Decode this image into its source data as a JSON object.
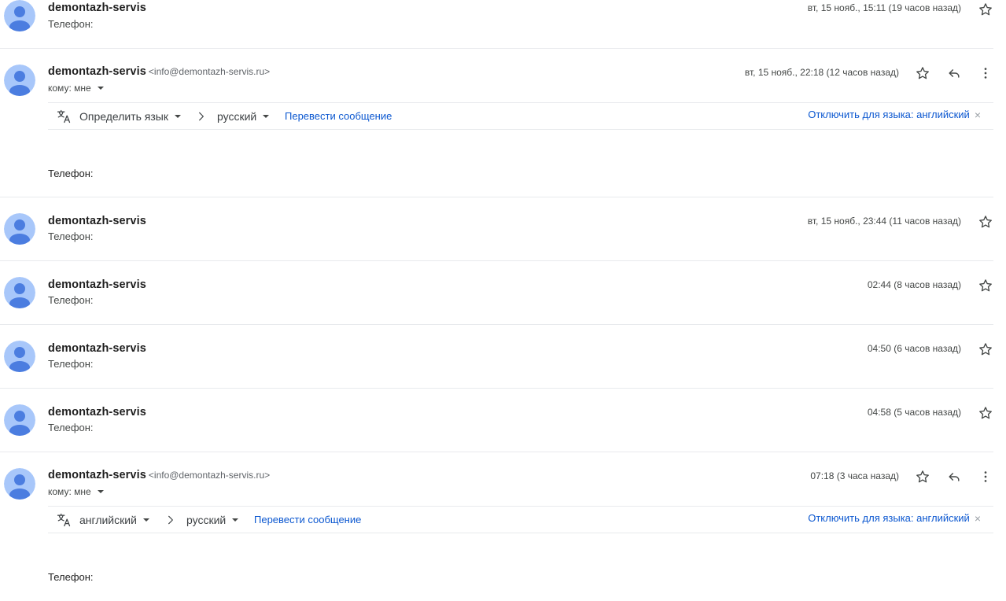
{
  "messages": [
    {
      "sender": "demontazh-servis",
      "snippet": "Телефон:",
      "date": "вт, 15 нояб., 15:11 (19 часов назад)"
    },
    {
      "sender": "demontazh-servis",
      "email": "<info@demontazh-servis.ru>",
      "to_label": "кому: мне",
      "date": "вт, 15 нояб., 22:18 (12 часов назад)",
      "translate": {
        "source_lang": "Определить язык",
        "target_lang": "русский",
        "translate_link": "Перевести сообщение",
        "turn_off": "Отключить для языка: английский",
        "close": "×"
      },
      "body": "Телефон:"
    },
    {
      "sender": "demontazh-servis",
      "snippet": "Телефон:",
      "date": "вт, 15 нояб., 23:44 (11 часов назад)"
    },
    {
      "sender": "demontazh-servis",
      "snippet": "Телефон:",
      "date": "02:44 (8 часов назад)"
    },
    {
      "sender": "demontazh-servis",
      "snippet": "Телефон:",
      "date": "04:50 (6 часов назад)"
    },
    {
      "sender": "demontazh-servis",
      "snippet": "Телефон:",
      "date": "04:58 (5 часов назад)"
    },
    {
      "sender": "demontazh-servis",
      "email": "<info@demontazh-servis.ru>",
      "to_label": "кому: мне",
      "date": "07:18 (3 часа назад)",
      "translate": {
        "source_lang": "английский",
        "target_lang": "русский",
        "translate_link": "Перевести сообщение",
        "turn_off": "Отключить для языка: английский",
        "close": "×"
      },
      "body": "Телефон:"
    }
  ],
  "icons": {
    "avatar": "person-avatar-icon",
    "star": "star-outline-icon",
    "reply": "reply-icon",
    "more": "more-vert-icon",
    "translate": "translate-icon",
    "chevron": "chevron-right-icon",
    "dropdown": "arrow-drop-down-icon"
  },
  "colors": {
    "avatar_bg": "#a8c7fa",
    "avatar_fg": "#4b7de0",
    "link": "#0b57d0",
    "divider": "#e8eaed"
  }
}
